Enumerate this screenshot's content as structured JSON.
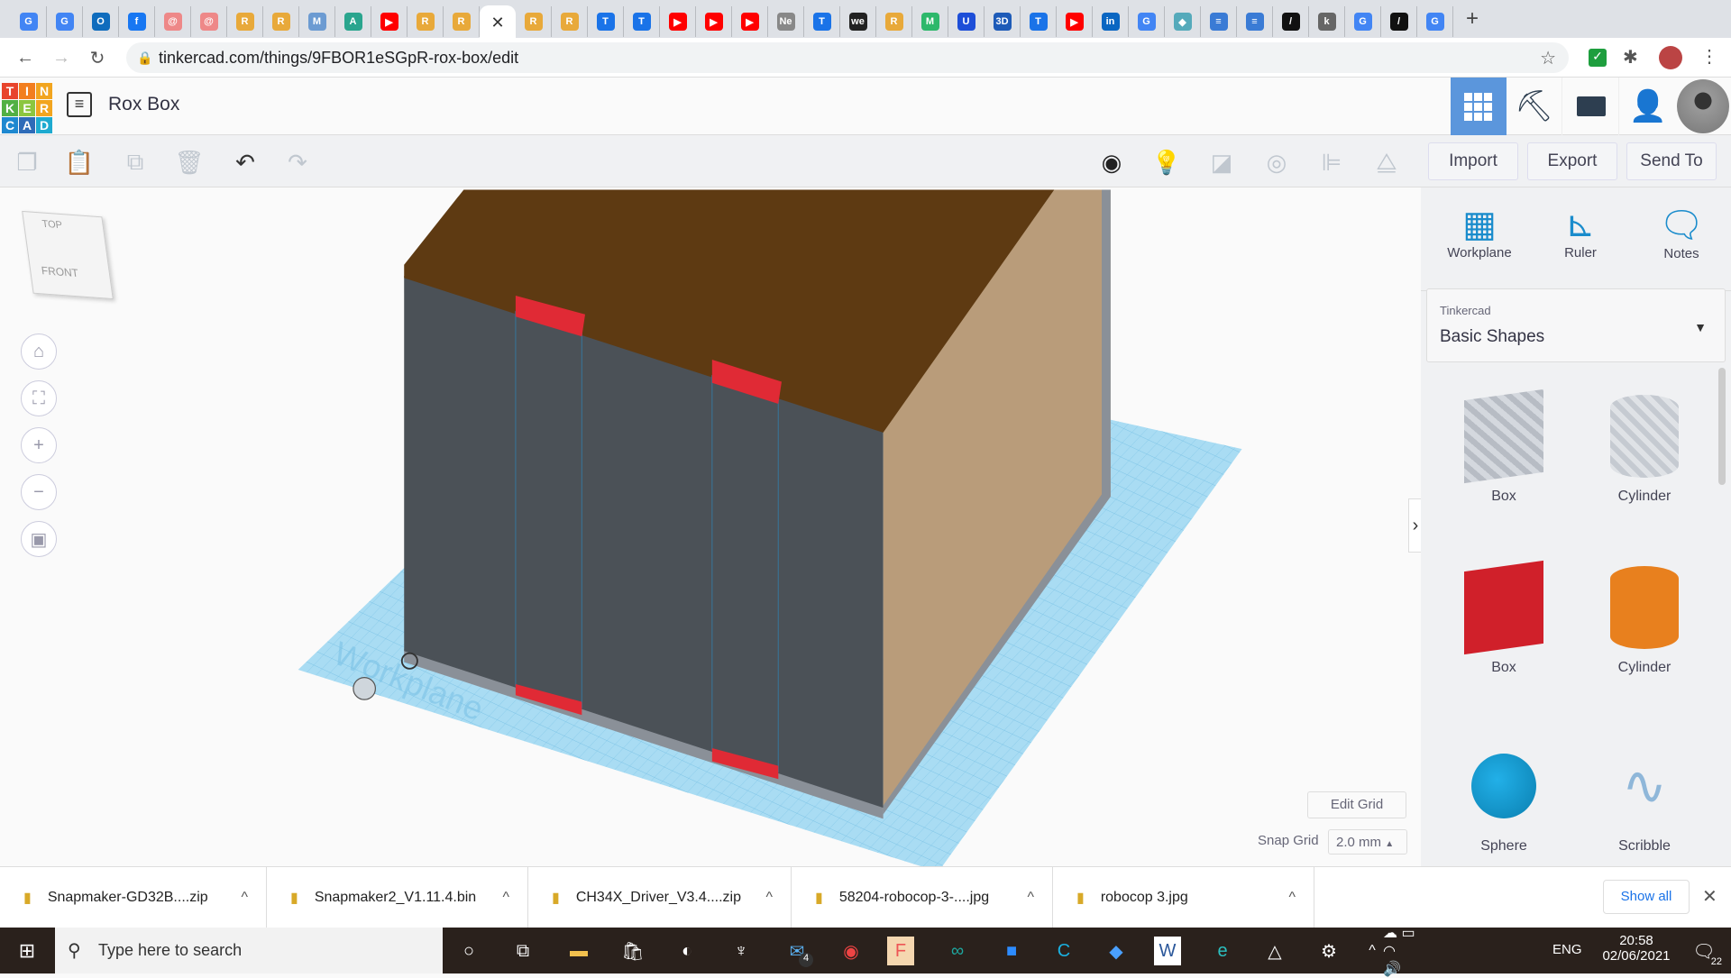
{
  "browser": {
    "tabs": [
      {
        "icon": "google-translate",
        "label": "G",
        "color": "#4285f4"
      },
      {
        "icon": "google-translate",
        "label": "G",
        "color": "#4285f4"
      },
      {
        "icon": "outlook",
        "label": "O",
        "color": "#0f6cbd"
      },
      {
        "icon": "facebook",
        "label": "f",
        "color": "#1877f2"
      },
      {
        "icon": "webmail",
        "label": "@",
        "color": "#e88"
      },
      {
        "icon": "webmail",
        "label": "@",
        "color": "#e88"
      },
      {
        "icon": "robot",
        "label": "R",
        "color": "#e8a93a"
      },
      {
        "icon": "robot",
        "label": "R",
        "color": "#e8a93a"
      },
      {
        "icon": "m-hex",
        "label": "M",
        "color": "#6c9bd2"
      },
      {
        "icon": "autodesk",
        "label": "A",
        "color": "#2aa58e"
      },
      {
        "icon": "youtube",
        "label": "▶",
        "color": "#f00"
      },
      {
        "icon": "robot",
        "label": "R",
        "color": "#e8a93a"
      },
      {
        "icon": "robot",
        "label": "R",
        "color": "#e8a93a"
      },
      {
        "icon": "close",
        "label": "✕",
        "color": "",
        "active": true
      },
      {
        "icon": "robot",
        "label": "R",
        "color": "#e8a93a"
      },
      {
        "icon": "robot",
        "label": "R",
        "color": "#e8a93a"
      },
      {
        "icon": "t-circle",
        "label": "T",
        "color": "#1a73e8"
      },
      {
        "icon": "t-circle",
        "label": "T",
        "color": "#1a73e8"
      },
      {
        "icon": "youtube",
        "label": "▶",
        "color": "#f00"
      },
      {
        "icon": "youtube",
        "label": "▶",
        "color": "#f00"
      },
      {
        "icon": "youtube",
        "label": "▶",
        "color": "#f00"
      },
      {
        "icon": "netflix",
        "label": "Ne",
        "color": "#888"
      },
      {
        "icon": "t-circle",
        "label": "T",
        "color": "#1a73e8"
      },
      {
        "icon": "we",
        "label": "we",
        "color": "#222"
      },
      {
        "icon": "robot",
        "label": "R",
        "color": "#e8a93a"
      },
      {
        "icon": "m-green",
        "label": "M",
        "color": "#2db86b"
      },
      {
        "icon": "u-blue",
        "label": "U",
        "color": "#1d4ed8"
      },
      {
        "icon": "3d",
        "label": "3D",
        "color": "#1e5bb8"
      },
      {
        "icon": "t-circle",
        "label": "T",
        "color": "#1a73e8"
      },
      {
        "icon": "youtube",
        "label": "▶",
        "color": "#f00"
      },
      {
        "icon": "linkedin",
        "label": "in",
        "color": "#0a66c2"
      },
      {
        "icon": "google",
        "label": "G",
        "color": "#4285f4"
      },
      {
        "icon": "puzzle",
        "label": "◆",
        "color": "#5ab"
      },
      {
        "icon": "layers",
        "label": "≡",
        "color": "#3a7bd5"
      },
      {
        "icon": "layers",
        "label": "≡",
        "color": "#3a7bd5"
      },
      {
        "icon": "slash",
        "label": "/",
        "color": "#111"
      },
      {
        "icon": "chart",
        "label": "k",
        "color": "#666"
      },
      {
        "icon": "google",
        "label": "G",
        "color": "#4285f4"
      },
      {
        "icon": "slash",
        "label": "/",
        "color": "#111"
      },
      {
        "icon": "google",
        "label": "G",
        "color": "#4285f4"
      }
    ],
    "new_tab": "+",
    "url": "tinkercad.com/things/9FBOR1eSGpR-rox-box/edit"
  },
  "app": {
    "logo": [
      "T",
      "I",
      "N",
      "K",
      "E",
      "R",
      "C",
      "A",
      "D"
    ],
    "title": "Rox Box",
    "toolbar": {
      "import": "Import",
      "export": "Export",
      "send_to": "Send To"
    },
    "viewcube": {
      "top": "TOP",
      "front": "FRONT"
    },
    "workplane_label": "Workplane",
    "edit_grid": "Edit Grid",
    "snap_grid_label": "Snap Grid",
    "snap_grid_value": "2.0 mm"
  },
  "panel": {
    "tools": [
      {
        "label": "Workplane"
      },
      {
        "label": "Ruler"
      },
      {
        "label": "Notes"
      }
    ],
    "library_source": "Tinkercad",
    "library_name": "Basic Shapes",
    "shapes": [
      {
        "label": "Box",
        "color": "#b7bcc4"
      },
      {
        "label": "Cylinder",
        "color": "#c5cad1"
      },
      {
        "label": "Box",
        "color": "#d0202a"
      },
      {
        "label": "Cylinder",
        "color": "#e8801e"
      },
      {
        "label": "Sphere",
        "color": "#1a9cd0"
      },
      {
        "label": "Scribble",
        "color": "#8fb7d9"
      }
    ]
  },
  "downloads": {
    "items": [
      {
        "name": "Snapmaker-GD32B....zip"
      },
      {
        "name": "Snapmaker2_V1.11.4.bin"
      },
      {
        "name": "CH34X_Driver_V3.4....zip"
      },
      {
        "name": "58204-robocop-3-....jpg"
      },
      {
        "name": "robocop 3.jpg"
      }
    ],
    "show_all": "Show all"
  },
  "taskbar": {
    "search_placeholder": "Type here to search",
    "mail_badge": "4",
    "language": "ENG",
    "time": "20:58",
    "date": "02/06/2021",
    "notifications": "22"
  }
}
